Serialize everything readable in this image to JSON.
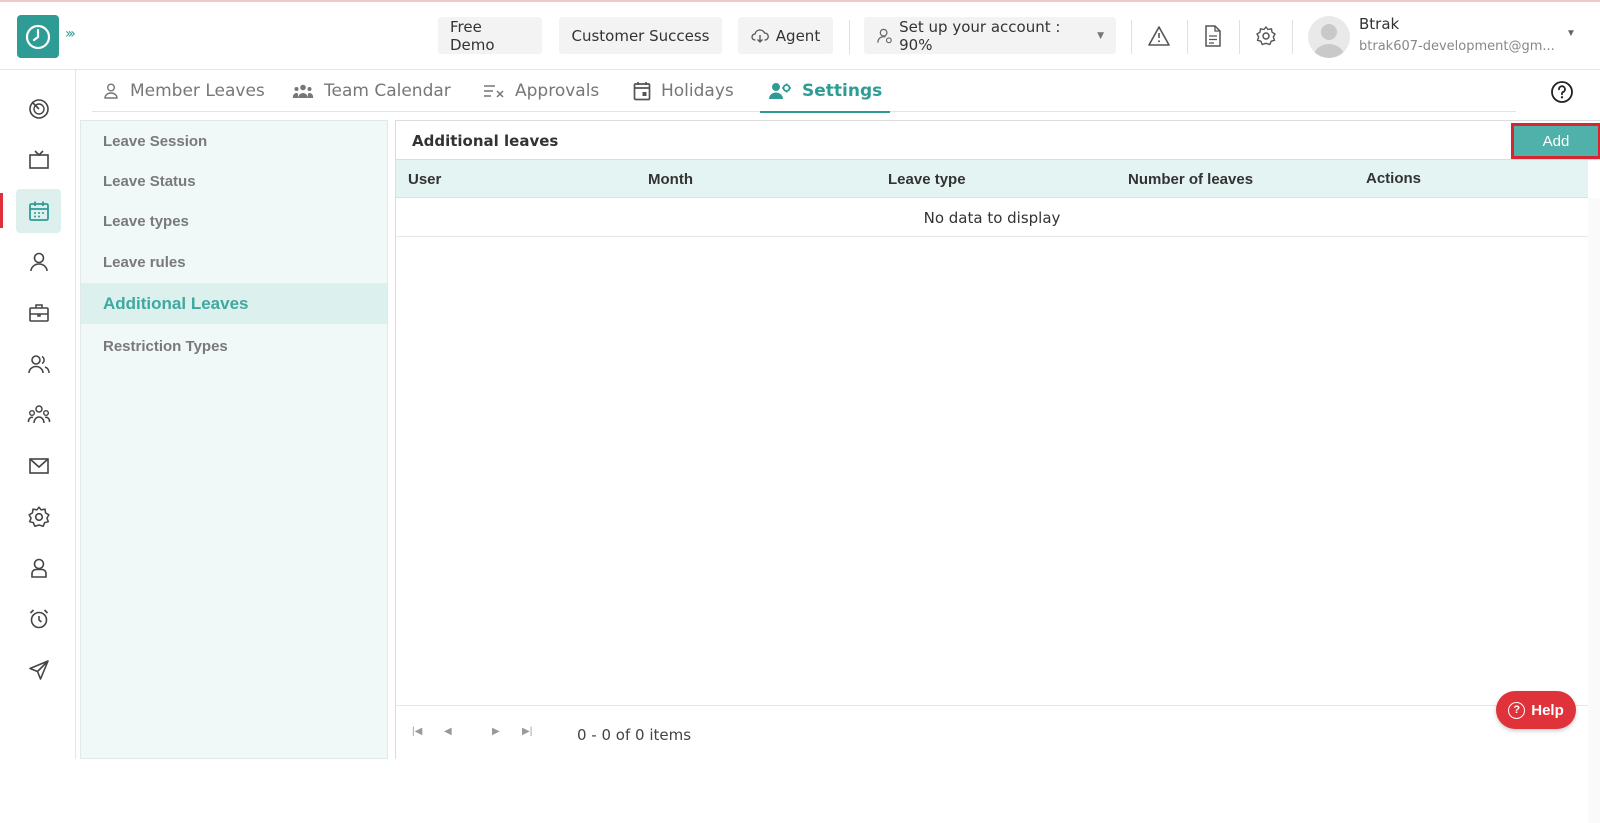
{
  "header": {
    "free_demo": "Free Demo",
    "customer_success": "Customer Success",
    "agent": "Agent",
    "setup": "Set up your account : 90%",
    "user_name": "Btrak",
    "user_email": "btrak607-development@gm..."
  },
  "tabs": [
    {
      "label": "Member Leaves",
      "icon": "person-icon"
    },
    {
      "label": "Team Calendar",
      "icon": "team-icon"
    },
    {
      "label": "Approvals",
      "icon": "approvals-icon"
    },
    {
      "label": "Holidays",
      "icon": "calendar-icon"
    },
    {
      "label": "Settings",
      "icon": "user-settings-icon",
      "active": true
    }
  ],
  "sidebar": {
    "items": [
      {
        "label": "Leave Session"
      },
      {
        "label": "Leave Status"
      },
      {
        "label": "Leave types"
      },
      {
        "label": "Leave rules"
      },
      {
        "label": "Additional Leaves",
        "active": true
      },
      {
        "label": "Restriction Types"
      }
    ]
  },
  "panel": {
    "title": "Additional leaves",
    "add_label": "Add",
    "columns": [
      "User",
      "Month",
      "Leave type",
      "Number of leaves",
      "Actions"
    ],
    "empty_text": "No data to display",
    "pager_info": "0 - 0 of 0 items"
  },
  "help": {
    "label": "Help"
  },
  "colors": {
    "accent": "#2e9c95",
    "danger": "#e0323b"
  }
}
